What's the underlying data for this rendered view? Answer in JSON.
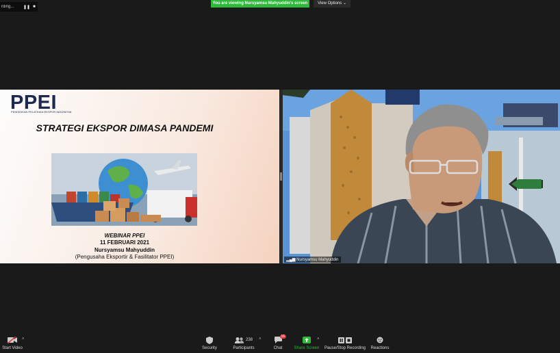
{
  "recording": {
    "label": "rding...",
    "pause_icon": "pause-icon",
    "stop_icon": "stop-icon"
  },
  "banner": "You are viewing Nursyamsu Mahyuddin's screen",
  "view_options": "View Options ⌄",
  "slide": {
    "logo": "PPEI",
    "logo_sub": "PENDIDIKAN PELATIHAN EKSPOR INDONESIA",
    "title": "STRATEGI EKSPOR DIMASA PANDEMI",
    "webinar": "WEBINAR PPEI",
    "date": "11 FEBRUARI 2021",
    "presenter": "Nursyamsu Mahyuddin",
    "role": "(Pengusaha Eksportir & Fasilitator PPEI)"
  },
  "video": {
    "name": "Nursyamsu Mahyuddin",
    "sign": "PPEI"
  },
  "toolbar": {
    "start_video": "Start Video",
    "security": "Security",
    "participants": "Participants",
    "participants_count": "238",
    "chat": "Chat",
    "chat_badge": "16",
    "share_screen": "Share Screen",
    "pause_stop": "Pause/Stop Recording",
    "reactions": "Reactions"
  },
  "colors": {
    "banner": "#2fb93a",
    "share": "#2fb93a",
    "badge": "#e0373c"
  }
}
